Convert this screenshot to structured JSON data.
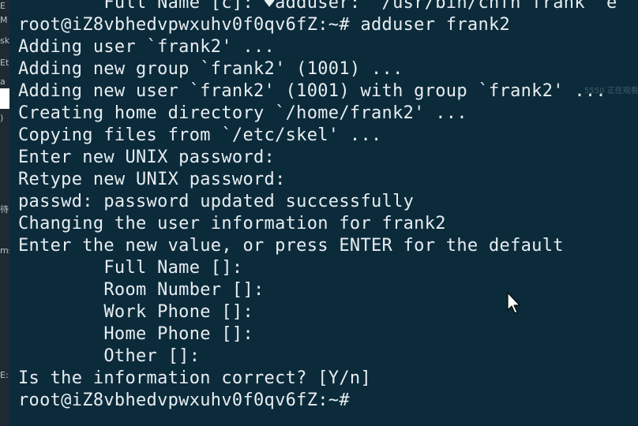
{
  "terminal": {
    "lines": [
      "        Full Name [c]: ♥adduser: `/usr/bin/chfn frank` e",
      "root@iZ8vbhedvpwxuhv0f0qv6fZ:~# adduser frank2",
      "Adding user `frank2' ...",
      "Adding new group `frank2' (1001) ...",
      "Adding new user `frank2' (1001) with group `frank2' ...",
      "Creating home directory `/home/frank2' ...",
      "Copying files from `/etc/skel' ...",
      "Enter new UNIX password:",
      "Retype new UNIX password:",
      "passwd: password updated successfully",
      "Changing the user information for frank2",
      "Enter the new value, or press ENTER for the default",
      "        Full Name []:",
      "        Room Number []:",
      "        Work Phone []:",
      "        Home Phone []:",
      "        Other []:",
      "Is the information correct? [Y/n]",
      "root@iZ8vbhedvpwxuhv0f0qv6fZ:~#"
    ],
    "overlay_text": "5550 正在观看"
  },
  "left_sliver": {
    "labels": [
      "E",
      "M",
      "sk",
      "Et",
      "a",
      ")",
      "待",
      "ms",
      "E:"
    ]
  },
  "colors": {
    "terminal_bg": "#0b2b3b",
    "terminal_fg": "#e8edf0"
  },
  "icons": {
    "cursor": "mouse-pointer-icon"
  }
}
